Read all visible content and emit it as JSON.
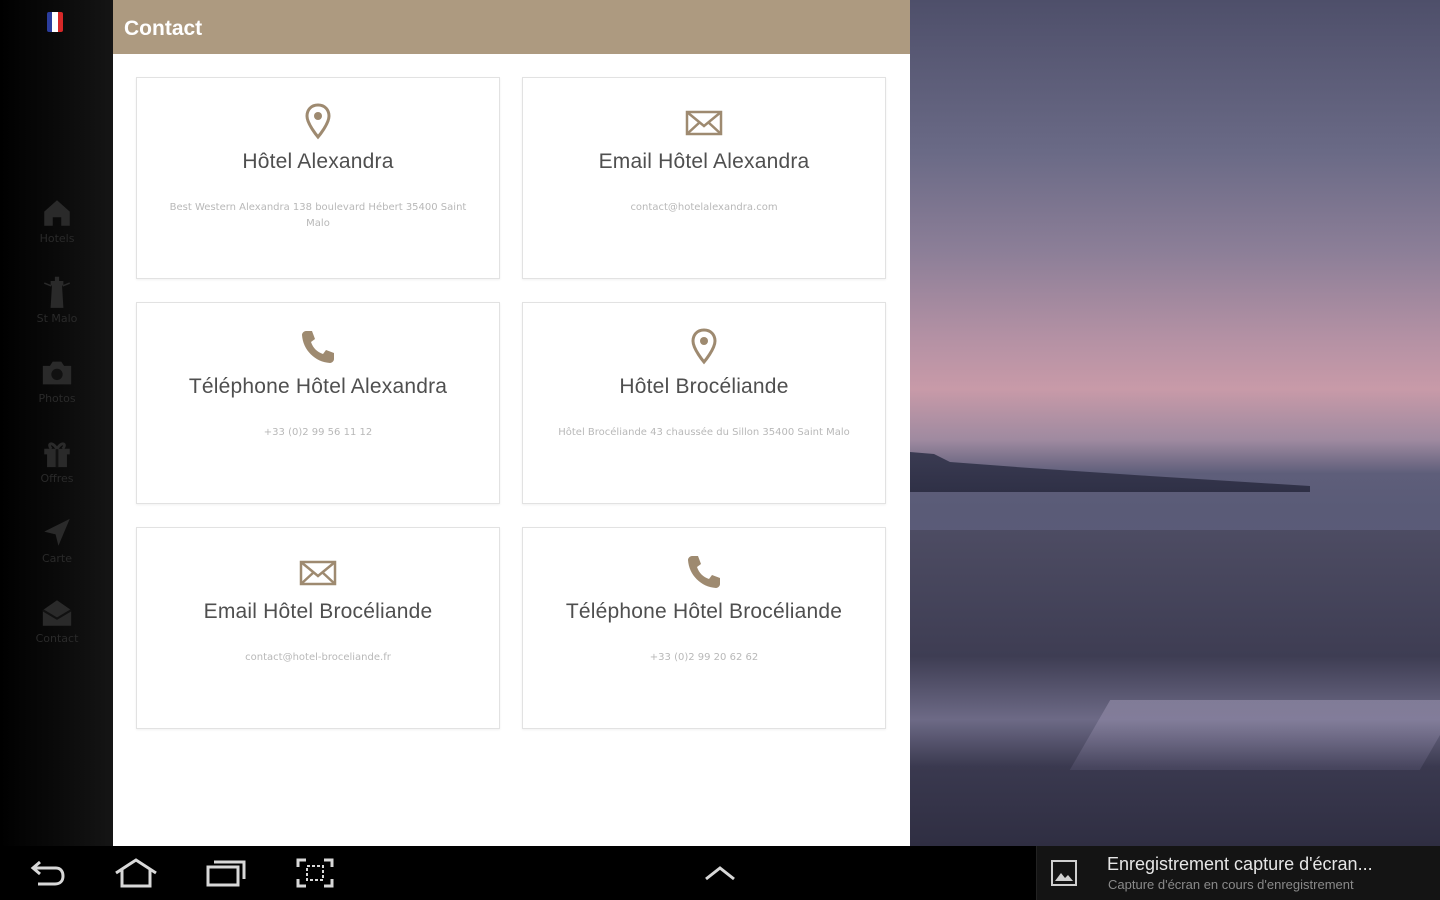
{
  "header": {
    "title": "Contact"
  },
  "sidebar": {
    "items": [
      {
        "label": "Hotels",
        "icon": "home-icon"
      },
      {
        "label": "St Malo",
        "icon": "lighthouse-icon"
      },
      {
        "label": "Photos",
        "icon": "camera-icon"
      },
      {
        "label": "Offres",
        "icon": "gift-icon"
      },
      {
        "label": "Carte",
        "icon": "navigation-arrow-icon"
      },
      {
        "label": "Contact",
        "icon": "envelope-icon"
      }
    ]
  },
  "cards": [
    {
      "title": "Hôtel Alexandra",
      "subtitle": "Best Western Alexandra 138 boulevard Hébert 35400 Saint Malo",
      "icon": "map-pin-icon"
    },
    {
      "title": "Email Hôtel Alexandra",
      "subtitle": "contact@hotelalexandra.com",
      "icon": "envelope-icon"
    },
    {
      "title": "Téléphone Hôtel Alexandra",
      "subtitle": "+33 (0)2 99 56 11 12",
      "icon": "phone-icon"
    },
    {
      "title": "Hôtel Brocéliande",
      "subtitle": "Hôtel Brocéliande 43 chaussée du Sillon 35400 Saint Malo",
      "icon": "map-pin-icon"
    },
    {
      "title": "Email Hôtel Brocéliande",
      "subtitle": "contact@hotel-broceliande.fr",
      "icon": "envelope-icon"
    },
    {
      "title": "Téléphone Hôtel Brocéliande",
      "subtitle": "+33 (0)2 99 20 62 62",
      "icon": "phone-icon"
    }
  ],
  "notification": {
    "title": "Enregistrement capture d'écran...",
    "subtitle": "Capture d'écran en cours d'enregistrement",
    "icon": "image-icon"
  },
  "colors": {
    "accent": "#ad9a80",
    "icon": "#9e8a70"
  }
}
